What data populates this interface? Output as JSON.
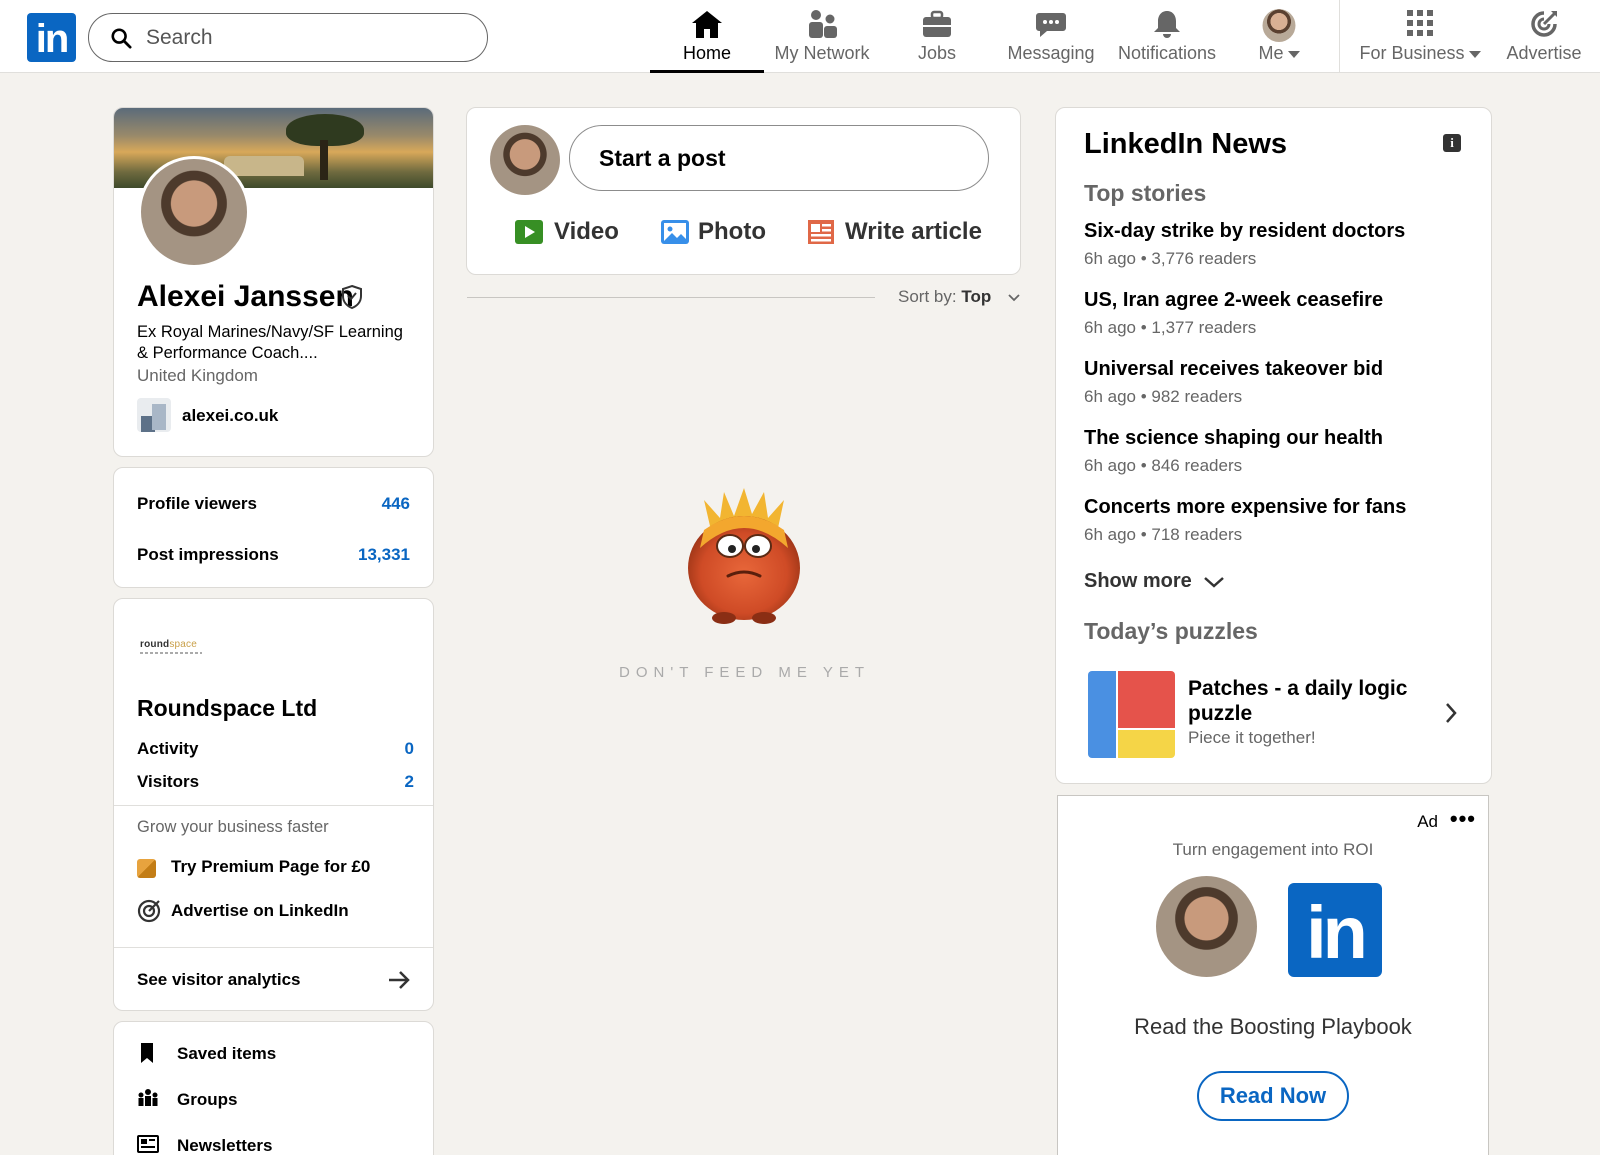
{
  "nav": {
    "search_placeholder": "Search",
    "items": [
      {
        "label": "Home",
        "icon": "home-icon"
      },
      {
        "label": "My Network",
        "icon": "network-icon"
      },
      {
        "label": "Jobs",
        "icon": "briefcase-icon"
      },
      {
        "label": "Messaging",
        "icon": "messaging-icon"
      },
      {
        "label": "Notifications",
        "icon": "bell-icon"
      },
      {
        "label": "Me",
        "icon": "avatar"
      },
      {
        "label": "For Business",
        "icon": "grid-icon"
      },
      {
        "label": "Advertise",
        "icon": "advertise-icon"
      }
    ],
    "logo_text": "in"
  },
  "profile": {
    "name": "Alexei Janssen",
    "headline": "Ex Royal Marines/Navy/SF Learning & Performance Coach....",
    "location": "United Kingdom",
    "website": "alexei.co.uk"
  },
  "stats": {
    "viewers_label": "Profile viewers",
    "viewers_value": "446",
    "impressions_label": "Post impressions",
    "impressions_value": "13,331"
  },
  "page": {
    "logo_text_1": "round",
    "logo_text_2": "space",
    "name": "Roundspace Ltd",
    "activity_label": "Activity",
    "activity_value": "0",
    "visitors_label": "Visitors",
    "visitors_value": "2",
    "grow_text": "Grow your business faster",
    "premium_label": "Try Premium Page for £0",
    "advertise_label": "Advertise on LinkedIn",
    "analytics_label": "See visitor analytics"
  },
  "shortcuts": [
    {
      "label": "Saved items"
    },
    {
      "label": "Groups"
    },
    {
      "label": "Newsletters"
    }
  ],
  "composer": {
    "start_post": "Start a post",
    "video": "Video",
    "photo": "Photo",
    "article": "Write article"
  },
  "feed": {
    "sort_label": "Sort by:",
    "sort_value": "Top",
    "empty_text": "DON'T FEED ME YET"
  },
  "news": {
    "title": "LinkedIn News",
    "top_stories": "Top stories",
    "stories": [
      {
        "headline": "Six-day strike by resident doctors",
        "meta": "6h ago • 3,776 readers"
      },
      {
        "headline": "US, Iran agree 2-week ceasefire",
        "meta": "6h ago • 1,377 readers"
      },
      {
        "headline": "Universal receives takeover bid",
        "meta": "6h ago • 982 readers"
      },
      {
        "headline": "The science shaping our health",
        "meta": "6h ago • 846 readers"
      },
      {
        "headline": "Concerts more expensive for fans",
        "meta": "6h ago • 718 readers"
      }
    ],
    "show_more": "Show more",
    "puzzles_title": "Today’s puzzles",
    "puzzle_name": "Patches - a daily logic puzzle",
    "puzzle_sub": "Piece it together!"
  },
  "ad": {
    "label": "Ad",
    "more": "•••",
    "tagline": "Turn engagement into ROI",
    "logo_text": "in",
    "headline": "Read the Boosting Playbook",
    "button": "Read Now"
  }
}
